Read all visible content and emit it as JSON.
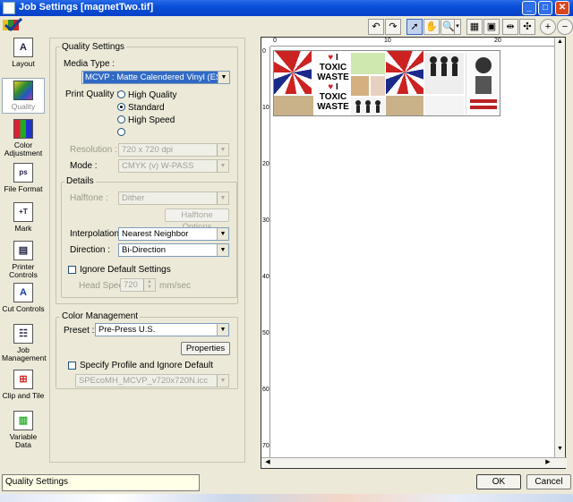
{
  "window": {
    "title": "Job Settings [magnetTwo.tif]"
  },
  "nav": [
    {
      "label": "Layout"
    },
    {
      "label": "Quality"
    },
    {
      "label": "Color Adjustment"
    },
    {
      "label": "File Format"
    },
    {
      "label": "Mark"
    },
    {
      "label": "Printer Controls"
    },
    {
      "label": "Cut Controls"
    },
    {
      "label": "Job Management"
    },
    {
      "label": "Clip and Tile"
    },
    {
      "label": "Variable Data"
    }
  ],
  "quality": {
    "group_title": "Quality Settings",
    "media_type_label": "Media Type :",
    "media_type_value": "MCVP : Matte Calendered Vinyl (ESM)",
    "print_quality_label": "Print Quality :",
    "pq_options": [
      "High Quality",
      "Standard",
      "High Speed",
      ""
    ],
    "pq_selected": "Standard",
    "resolution_label": "Resolution :",
    "resolution_value": "720 x 720 dpi",
    "mode_label": "Mode :",
    "mode_value": "CMYK (v) W-PASS"
  },
  "details": {
    "group_title": "Details",
    "halftone_label": "Halftone :",
    "halftone_value": "Dither",
    "halftone_options_button": "Halftone Options",
    "interpolation_label": "Interpolation :",
    "interpolation_value": "Nearest Neighbor",
    "direction_label": "Direction :",
    "direction_value": "Bi-Direction",
    "ignore_default_label": "Ignore Default Settings",
    "head_speed_label": "Head Speed",
    "head_speed_value": "720",
    "head_speed_unit": "mm/sec"
  },
  "color_management": {
    "group_title": "Color Management",
    "preset_label": "Preset :",
    "preset_value": "Pre-Press U.S.",
    "properties_button": "Properties",
    "specify_profile_label": "Specify Profile and Ignore Default",
    "profile_value": "SPEcoMH_MCVP_v720x720N.icc"
  },
  "preview": {
    "ruler_top_marks": [
      "0",
      "10",
      "20"
    ],
    "ruler_left_marks": [
      "0",
      "10",
      "20",
      "30",
      "40",
      "50",
      "60",
      "70"
    ],
    "tile_texts": {
      "i": "I",
      "toxic": "TOXIC",
      "waste": "WASTE"
    }
  },
  "status": {
    "text": "Quality Settings"
  },
  "buttons": {
    "ok": "OK",
    "cancel": "Cancel"
  }
}
